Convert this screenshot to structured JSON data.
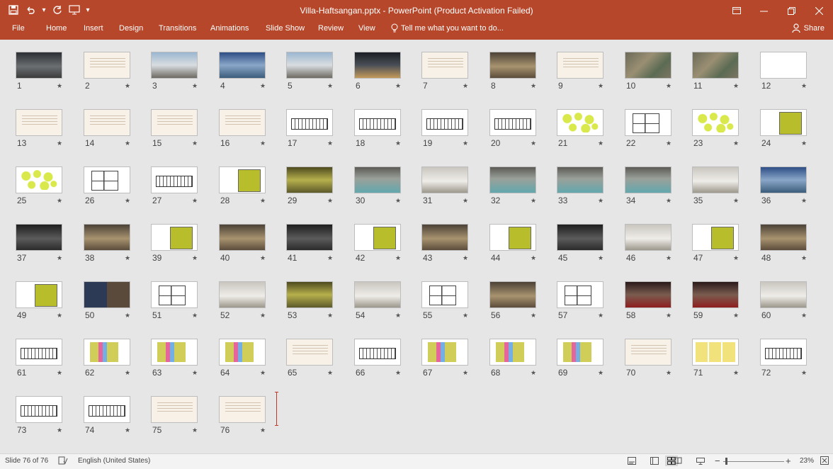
{
  "window": {
    "title": "Villa-Haftsangan.pptx - PowerPoint (Product Activation Failed)",
    "qat_icons": [
      "save-icon",
      "undo-icon",
      "undo-dropdown-icon",
      "redo-icon",
      "present-from-start-icon",
      "customize-qat-icon"
    ],
    "controls": [
      "ribbon-display-icon",
      "minimize-icon",
      "restore-icon",
      "close-icon"
    ]
  },
  "ribbon": {
    "tabs": [
      "File",
      "Home",
      "Insert",
      "Design",
      "Transitions",
      "Animations",
      "Slide Show",
      "Review",
      "View"
    ],
    "tell_me": "Tell me what you want to do...",
    "share": "Share"
  },
  "slides": [
    {
      "n": "1",
      "style": "t-photo-dark"
    },
    {
      "n": "2",
      "style": "t-text"
    },
    {
      "n": "3",
      "style": "t-photo-day"
    },
    {
      "n": "4",
      "style": "t-photo-blue"
    },
    {
      "n": "5",
      "style": "t-photo-day"
    },
    {
      "n": "6",
      "style": "t-photo-night"
    },
    {
      "n": "7",
      "style": "t-text"
    },
    {
      "n": "8",
      "style": "t-interior"
    },
    {
      "n": "9",
      "style": "t-text"
    },
    {
      "n": "10",
      "style": "t-map"
    },
    {
      "n": "11",
      "style": "t-map"
    },
    {
      "n": "12",
      "style": "t-white"
    },
    {
      "n": "13",
      "style": "t-text"
    },
    {
      "n": "14",
      "style": "t-text"
    },
    {
      "n": "15",
      "style": "t-text"
    },
    {
      "n": "16",
      "style": "t-text"
    },
    {
      "n": "17",
      "style": "t-elev"
    },
    {
      "n": "18",
      "style": "t-elev"
    },
    {
      "n": "19",
      "style": "t-elev"
    },
    {
      "n": "20",
      "style": "t-elev"
    },
    {
      "n": "21",
      "style": "t-bubble"
    },
    {
      "n": "22",
      "style": "t-plan"
    },
    {
      "n": "23",
      "style": "t-bubble"
    },
    {
      "n": "24",
      "style": "t-yellowplan"
    },
    {
      "n": "25",
      "style": "t-bubble"
    },
    {
      "n": "26",
      "style": "t-plan"
    },
    {
      "n": "27",
      "style": "t-elev"
    },
    {
      "n": "28",
      "style": "t-yellowplan"
    },
    {
      "n": "29",
      "style": "t-olive"
    },
    {
      "n": "30",
      "style": "t-pool"
    },
    {
      "n": "31",
      "style": "t-interior-light"
    },
    {
      "n": "32",
      "style": "t-pool"
    },
    {
      "n": "33",
      "style": "t-pool"
    },
    {
      "n": "34",
      "style": "t-pool"
    },
    {
      "n": "35",
      "style": "t-interior-light"
    },
    {
      "n": "36",
      "style": "t-photo-blue"
    },
    {
      "n": "37",
      "style": "t-interior-dark"
    },
    {
      "n": "38",
      "style": "t-interior"
    },
    {
      "n": "39",
      "style": "t-yellowplan"
    },
    {
      "n": "40",
      "style": "t-interior"
    },
    {
      "n": "41",
      "style": "t-interior-dark"
    },
    {
      "n": "42",
      "style": "t-yellowplan"
    },
    {
      "n": "43",
      "style": "t-interior"
    },
    {
      "n": "44",
      "style": "t-yellowplan"
    },
    {
      "n": "45",
      "style": "t-interior-dark"
    },
    {
      "n": "46",
      "style": "t-interior-light"
    },
    {
      "n": "47",
      "style": "t-yellowplan"
    },
    {
      "n": "48",
      "style": "t-interior"
    },
    {
      "n": "49",
      "style": "t-yellowplan"
    },
    {
      "n": "50",
      "style": "t-split-photo"
    },
    {
      "n": "51",
      "style": "t-plan"
    },
    {
      "n": "52",
      "style": "t-interior-light"
    },
    {
      "n": "53",
      "style": "t-olive"
    },
    {
      "n": "54",
      "style": "t-interior-light"
    },
    {
      "n": "55",
      "style": "t-plan"
    },
    {
      "n": "56",
      "style": "t-interior"
    },
    {
      "n": "57",
      "style": "t-plan"
    },
    {
      "n": "58",
      "style": "t-red"
    },
    {
      "n": "59",
      "style": "t-red"
    },
    {
      "n": "60",
      "style": "t-interior-light"
    },
    {
      "n": "61",
      "style": "t-elev"
    },
    {
      "n": "62",
      "style": "t-color-plan"
    },
    {
      "n": "63",
      "style": "t-color-plan"
    },
    {
      "n": "64",
      "style": "t-color-plan"
    },
    {
      "n": "65",
      "style": "t-text"
    },
    {
      "n": "66",
      "style": "t-elev"
    },
    {
      "n": "67",
      "style": "t-color-plan"
    },
    {
      "n": "68",
      "style": "t-color-plan"
    },
    {
      "n": "69",
      "style": "t-color-plan"
    },
    {
      "n": "70",
      "style": "t-text"
    },
    {
      "n": "71",
      "style": "t-boards"
    },
    {
      "n": "72",
      "style": "t-elev"
    },
    {
      "n": "73",
      "style": "t-elev"
    },
    {
      "n": "74",
      "style": "t-elev"
    },
    {
      "n": "75",
      "style": "t-text"
    },
    {
      "n": "76",
      "style": "t-text"
    }
  ],
  "star_glyph": "★",
  "status": {
    "slide_counter": "Slide 76 of 76",
    "language": "English (United States)",
    "zoom": "23%",
    "zoom_fraction": 0.23
  },
  "colors": {
    "accent": "#b7472a",
    "sorter_bg": "#e6e6e6"
  }
}
